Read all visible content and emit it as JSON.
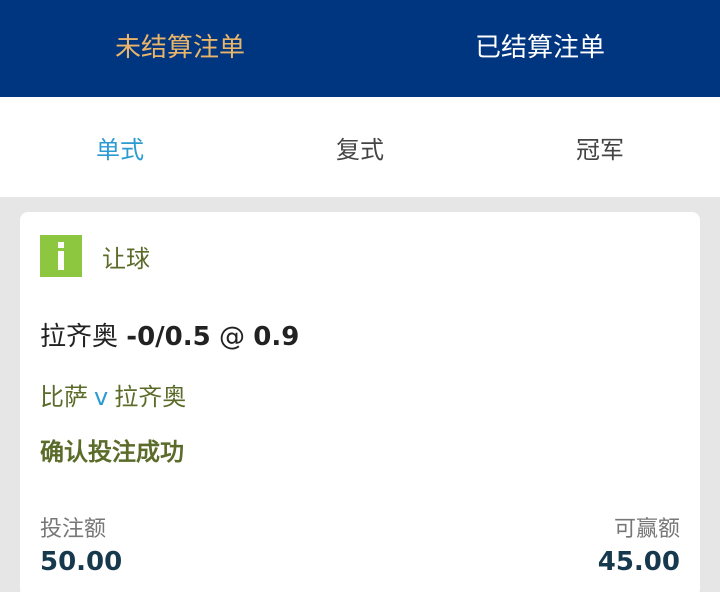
{
  "top_tabs": [
    {
      "label": "未结算注单",
      "active": true
    },
    {
      "label": "已结算注单",
      "active": false
    }
  ],
  "sub_tabs": [
    {
      "label": "单式",
      "active": true
    },
    {
      "label": "复式",
      "active": false
    },
    {
      "label": "冠军",
      "active": false
    }
  ],
  "bet": {
    "market_icon": "info-icon",
    "market": "让球",
    "selection_team": "拉齐奥",
    "selection_line": "-0/0.5",
    "at": "@",
    "odds": "0.9",
    "home_team": "比萨",
    "vs": "v",
    "away_team": "拉齐奥",
    "status": "确认投注成功",
    "stake_label": "投注额",
    "stake_value": "50.00",
    "payout_label": "可赢额",
    "payout_value": "45.00"
  },
  "colors": {
    "header_bg": "#003580",
    "active_top_tab": "#e9b56a",
    "active_sub_tab": "#2b9bd2",
    "icon_bg": "#8dc63f",
    "accent_text": "#5b6b2a"
  }
}
